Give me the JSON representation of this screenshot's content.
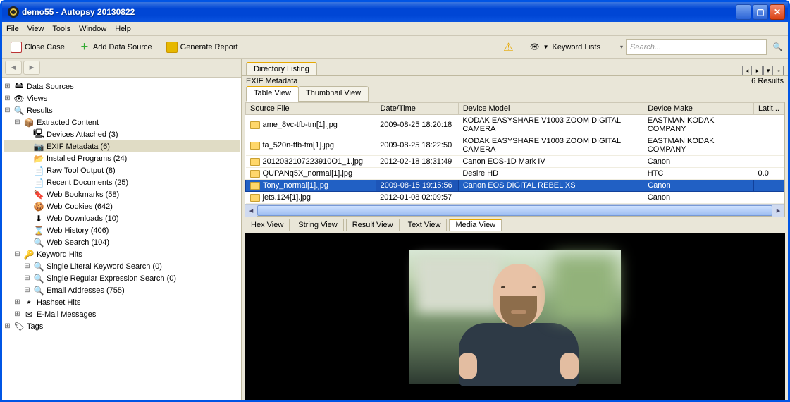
{
  "window": {
    "title": "demo55 - Autopsy 20130822"
  },
  "menu": {
    "items": [
      "File",
      "View",
      "Tools",
      "Window",
      "Help"
    ]
  },
  "toolbar": {
    "close_case": "Close Case",
    "add_source": "Add Data Source",
    "gen_report": "Generate Report",
    "keyword_lists": "Keyword Lists",
    "search_placeholder": "Search..."
  },
  "tree": {
    "dataSources": "Data Sources",
    "views": "Views",
    "results": "Results",
    "extracted": "Extracted Content",
    "items": [
      {
        "label": "Devices Attached (3)",
        "icon": "🖳"
      },
      {
        "label": "EXIF Metadata (6)",
        "icon": "📷",
        "sel": true
      },
      {
        "label": "Installed Programs (24)",
        "icon": "📂"
      },
      {
        "label": "Raw Tool Output (8)",
        "icon": "📄"
      },
      {
        "label": "Recent Documents (25)",
        "icon": "📄"
      },
      {
        "label": "Web Bookmarks (58)",
        "icon": "🔖"
      },
      {
        "label": "Web Cookies (642)",
        "icon": "🍪"
      },
      {
        "label": "Web Downloads (10)",
        "icon": "⬇"
      },
      {
        "label": "Web History (406)",
        "icon": "⌛"
      },
      {
        "label": "Web Search (104)",
        "icon": "🔍"
      }
    ],
    "kw": "Keyword Hits",
    "kw_items": [
      "Single Literal Keyword Search (0)",
      "Single Regular Expression Search (0)",
      "Email Addresses (755)"
    ],
    "hashset": "Hashset Hits",
    "email": "E-Mail Messages",
    "tags": "Tags"
  },
  "listing": {
    "tab": "Directory Listing",
    "heading": "EXIF Metadata",
    "count": "6  Results",
    "views": {
      "table": "Table View",
      "thumb": "Thumbnail View"
    },
    "columns": [
      "Source File",
      "Date/Time",
      "Device Model",
      "Device Make",
      "Latit..."
    ],
    "rows": [
      {
        "f": "ame_8vc-tfb-tm[1].jpg",
        "d": "2009-08-25 18:20:18",
        "m": "KODAK EASYSHARE V1003 ZOOM DIGITAL CAMERA",
        "k": "EASTMAN KODAK COMPANY",
        "l": ""
      },
      {
        "f": "ta_520n-tfb-tm[1].jpg",
        "d": "2009-08-25 18:22:50",
        "m": "KODAK EASYSHARE V1003 ZOOM DIGITAL CAMERA",
        "k": "EASTMAN KODAK COMPANY",
        "l": ""
      },
      {
        "f": "2012032107223910O1_1.jpg",
        "d": "2012-02-18 18:31:49",
        "m": "Canon EOS-1D Mark IV",
        "k": "Canon",
        "l": ""
      },
      {
        "f": "QUPANq5X_normal[1].jpg",
        "d": "",
        "m": "Desire HD",
        "k": "HTC",
        "l": "0.0"
      },
      {
        "f": "Tony_normal[1].jpg",
        "d": "2009-08-15 19:15:56",
        "m": "Canon EOS DIGITAL REBEL XS",
        "k": "Canon",
        "l": "",
        "sel": true
      },
      {
        "f": "jets.124[1].jpg",
        "d": "2012-01-08 02:09:57",
        "m": "",
        "k": "Canon",
        "l": ""
      }
    ]
  },
  "viewer": {
    "tabs": [
      "Hex View",
      "String View",
      "Result View",
      "Text View",
      "Media View"
    ],
    "active": 4
  }
}
